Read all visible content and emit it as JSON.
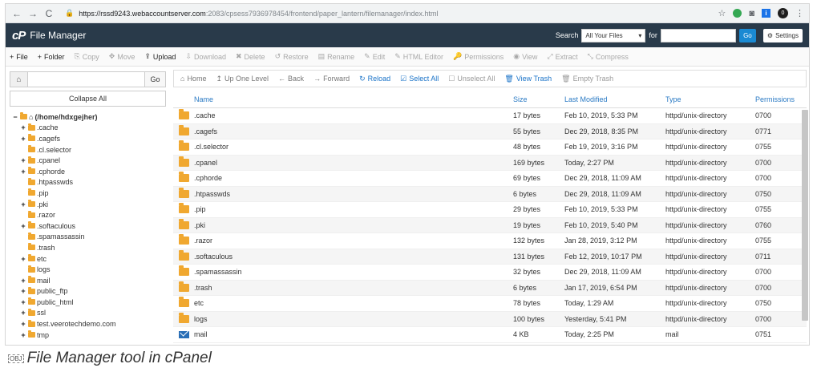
{
  "browser": {
    "back": "←",
    "forward": "→",
    "reload": "C",
    "url_host": "https://rssd9243.webaccountserver.com",
    "url_path": ":2083/cpsess7936978454/frontend/paper_lantern/filemanager/index.html",
    "avatar_letter": "0"
  },
  "header": {
    "logo": "cP",
    "title": "File Manager",
    "search_label": "Search",
    "scope_value": "All Your Files",
    "for_label": "for",
    "go_label": "Go",
    "settings_label": "Settings"
  },
  "toolbar": [
    {
      "icon": "+",
      "label": "File",
      "enabled": true
    },
    {
      "icon": "+",
      "label": "Folder",
      "enabled": true
    },
    {
      "icon": "⎘",
      "label": "Copy",
      "enabled": false
    },
    {
      "icon": "✥",
      "label": "Move",
      "enabled": false
    },
    {
      "icon": "⇪",
      "label": "Upload",
      "enabled": true
    },
    {
      "icon": "⇩",
      "label": "Download",
      "enabled": false
    },
    {
      "icon": "✖",
      "label": "Delete",
      "enabled": false
    },
    {
      "icon": "↺",
      "label": "Restore",
      "enabled": false
    },
    {
      "icon": "▤",
      "label": "Rename",
      "enabled": false
    },
    {
      "icon": "✎",
      "label": "Edit",
      "enabled": false
    },
    {
      "icon": "✎",
      "label": "HTML Editor",
      "enabled": false
    },
    {
      "icon": "🔑",
      "label": "Permissions",
      "enabled": false
    },
    {
      "icon": "◉",
      "label": "View",
      "enabled": false
    },
    {
      "icon": "⤢",
      "label": "Extract",
      "enabled": false
    },
    {
      "icon": "⤡",
      "label": "Compress",
      "enabled": false
    }
  ],
  "left": {
    "go_label": "Go",
    "collapse_label": "Collapse All",
    "root": "(/home/hdxgejher)",
    "tree": [
      {
        "name": ".cache",
        "expand": true
      },
      {
        "name": ".cagefs",
        "expand": true
      },
      {
        "name": ".cl.selector",
        "expand": false
      },
      {
        "name": ".cpanel",
        "expand": true
      },
      {
        "name": ".cphorde",
        "expand": true
      },
      {
        "name": ".htpasswds",
        "expand": false
      },
      {
        "name": ".pip",
        "expand": false
      },
      {
        "name": ".pki",
        "expand": true
      },
      {
        "name": ".razor",
        "expand": false
      },
      {
        "name": ".softaculous",
        "expand": true
      },
      {
        "name": ".spamassassin",
        "expand": false
      },
      {
        "name": ".trash",
        "expand": false
      },
      {
        "name": "etc",
        "expand": true
      },
      {
        "name": "logs",
        "expand": false
      },
      {
        "name": "mail",
        "expand": true
      },
      {
        "name": "public_ftp",
        "expand": true
      },
      {
        "name": "public_html",
        "expand": true
      },
      {
        "name": "ssl",
        "expand": true
      },
      {
        "name": "test.veerotechdemo.com",
        "expand": true
      },
      {
        "name": "tmp",
        "expand": true
      }
    ]
  },
  "nav": [
    {
      "icon": "⌂",
      "label": "Home",
      "style": "normal"
    },
    {
      "icon": "↥",
      "label": "Up One Level",
      "style": "normal"
    },
    {
      "icon": "←",
      "label": "Back",
      "style": "normal"
    },
    {
      "icon": "→",
      "label": "Forward",
      "style": "normal"
    },
    {
      "icon": "↻",
      "label": "Reload",
      "style": "link"
    },
    {
      "icon": "☑",
      "label": "Select All",
      "style": "link"
    },
    {
      "icon": "☐",
      "label": "Unselect All",
      "style": "dis"
    },
    {
      "icon": "🗑",
      "label": "View Trash",
      "style": "link"
    },
    {
      "icon": "🗑",
      "label": "Empty Trash",
      "style": "dis"
    }
  ],
  "columns": {
    "name": "Name",
    "size": "Size",
    "modified": "Last Modified",
    "type": "Type",
    "perms": "Permissions"
  },
  "files": [
    {
      "icon": "folder",
      "name": ".cache",
      "size": "17 bytes",
      "modified": "Feb 10, 2019, 5:33 PM",
      "type": "httpd/unix-directory",
      "perms": "0700"
    },
    {
      "icon": "folder",
      "name": ".cagefs",
      "size": "55 bytes",
      "modified": "Dec 29, 2018, 8:35 PM",
      "type": "httpd/unix-directory",
      "perms": "0771"
    },
    {
      "icon": "folder",
      "name": ".cl.selector",
      "size": "48 bytes",
      "modified": "Feb 19, 2019, 3:16 PM",
      "type": "httpd/unix-directory",
      "perms": "0755"
    },
    {
      "icon": "folder",
      "name": ".cpanel",
      "size": "169 bytes",
      "modified": "Today, 2:27 PM",
      "type": "httpd/unix-directory",
      "perms": "0700"
    },
    {
      "icon": "folder",
      "name": ".cphorde",
      "size": "69 bytes",
      "modified": "Dec 29, 2018, 11:09 AM",
      "type": "httpd/unix-directory",
      "perms": "0700"
    },
    {
      "icon": "folder",
      "name": ".htpasswds",
      "size": "6 bytes",
      "modified": "Dec 29, 2018, 11:09 AM",
      "type": "httpd/unix-directory",
      "perms": "0750"
    },
    {
      "icon": "folder",
      "name": ".pip",
      "size": "29 bytes",
      "modified": "Feb 10, 2019, 5:33 PM",
      "type": "httpd/unix-directory",
      "perms": "0755"
    },
    {
      "icon": "folder",
      "name": ".pki",
      "size": "19 bytes",
      "modified": "Feb 10, 2019, 5:40 PM",
      "type": "httpd/unix-directory",
      "perms": "0760"
    },
    {
      "icon": "folder",
      "name": ".razor",
      "size": "132 bytes",
      "modified": "Jan 28, 2019, 3:12 PM",
      "type": "httpd/unix-directory",
      "perms": "0755"
    },
    {
      "icon": "folder",
      "name": ".softaculous",
      "size": "131 bytes",
      "modified": "Feb 12, 2019, 10:17 PM",
      "type": "httpd/unix-directory",
      "perms": "0711"
    },
    {
      "icon": "folder",
      "name": ".spamassassin",
      "size": "32 bytes",
      "modified": "Dec 29, 2018, 11:09 AM",
      "type": "httpd/unix-directory",
      "perms": "0700"
    },
    {
      "icon": "folder",
      "name": ".trash",
      "size": "6 bytes",
      "modified": "Jan 17, 2019, 6:54 PM",
      "type": "httpd/unix-directory",
      "perms": "0700"
    },
    {
      "icon": "folder",
      "name": "etc",
      "size": "78 bytes",
      "modified": "Today, 1:29 AM",
      "type": "httpd/unix-directory",
      "perms": "0750"
    },
    {
      "icon": "folder",
      "name": "logs",
      "size": "100 bytes",
      "modified": "Yesterday, 5:41 PM",
      "type": "httpd/unix-directory",
      "perms": "0700"
    },
    {
      "icon": "mail",
      "name": "mail",
      "size": "4 KB",
      "modified": "Today, 2:25 PM",
      "type": "mail",
      "perms": "0751"
    }
  ],
  "caption": {
    "obj": "OBJ",
    "text": "File Manager tool in cPanel"
  }
}
